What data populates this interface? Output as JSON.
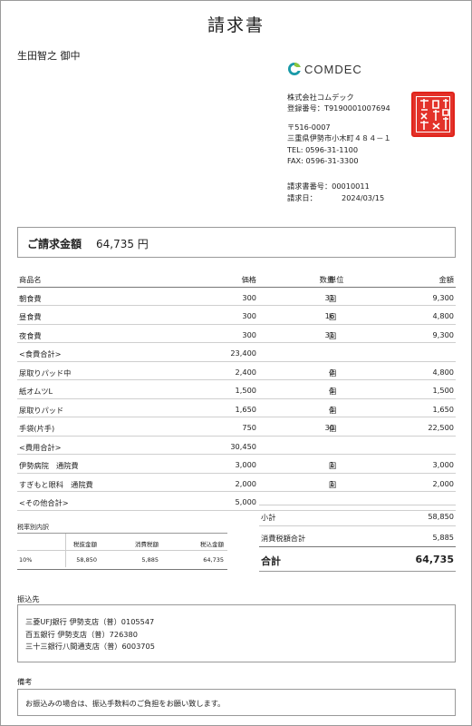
{
  "title": "請求書",
  "addressee": "生田智之 御中",
  "company": {
    "logo_text": "COMDEC",
    "name": "株式会社コムデック",
    "registration": "登録番号：T9190001007694",
    "postal": "〒516-0007",
    "address": "三重県伊勢市小木町４８４－１",
    "tel": "TEL: 0596-31-1100",
    "fax": "FAX: 0596-31-3300",
    "invoice_no": "請求書番号：00010011",
    "invoice_date_label": "請求日：",
    "invoice_date": "2024/03/15",
    "seal_text": "株式会社コムデック之印"
  },
  "total_box": {
    "label": "ご請求金額",
    "value": "64,735 円"
  },
  "items": {
    "headers": {
      "name": "商品名",
      "price": "価格",
      "qty": "数量",
      "unit": "単位",
      "amount": "金額"
    },
    "rows": [
      {
        "name": "朝食費",
        "price": "300",
        "qty": "31",
        "unit": "回",
        "amount": "9,300"
      },
      {
        "name": "昼食費",
        "price": "300",
        "qty": "16",
        "unit": "回",
        "amount": "4,800"
      },
      {
        "name": "夜食費",
        "price": "300",
        "qty": "31",
        "unit": "回",
        "amount": "9,300"
      },
      {
        "name": "<食費合計>",
        "price": "23,400",
        "qty": "",
        "unit": "",
        "amount": ""
      },
      {
        "name": "尿取りパッド中",
        "price": "2,400",
        "qty": "2",
        "unit": "個",
        "amount": "4,800"
      },
      {
        "name": "紙オムツL",
        "price": "1,500",
        "qty": "1",
        "unit": "個",
        "amount": "1,500"
      },
      {
        "name": "尿取りパッド",
        "price": "1,650",
        "qty": "1",
        "unit": "個",
        "amount": "1,650"
      },
      {
        "name": "手袋(片手)",
        "price": "750",
        "qty": "30",
        "unit": "個",
        "amount": "22,500"
      },
      {
        "name": "<費用合計>",
        "price": "30,450",
        "qty": "",
        "unit": "",
        "amount": ""
      },
      {
        "name": "伊勢病院　通院費",
        "price": "3,000",
        "qty": "1",
        "unit": "回",
        "amount": "3,000"
      },
      {
        "name": "すぎもと眼科　通院費",
        "price": "2,000",
        "qty": "1",
        "unit": "回",
        "amount": "2,000"
      },
      {
        "name": "<その他合計>",
        "price": "5,000",
        "qty": "",
        "unit": "",
        "amount": ""
      }
    ]
  },
  "tax_breakdown": {
    "title": "税率別内訳",
    "headers": {
      "excl": "税抜金額",
      "tax": "消費税額",
      "incl": "税込金額"
    },
    "row": {
      "rate": "10%",
      "excl": "58,850",
      "tax": "5,885",
      "incl": "64,735"
    }
  },
  "summary": {
    "subtotal_label": "小計",
    "subtotal": "58,850",
    "tax_label": "消費税額合計",
    "tax": "5,885",
    "total_label": "合計",
    "total": "64,735"
  },
  "bank": {
    "label": "振込先",
    "lines": [
      "三菱UFJ銀行 伊勢支店（普）0105547",
      "百五銀行 伊勢支店（普）726380",
      "三十三銀行八間通支店（普）6003705"
    ]
  },
  "note": {
    "label": "備考",
    "text": "お振込みの場合は、振込手数料のご負担をお願い致します。"
  },
  "colors": {
    "seal": "#e3322a",
    "logo_teal": "#1a9aa8",
    "logo_green": "#8cc63f"
  }
}
